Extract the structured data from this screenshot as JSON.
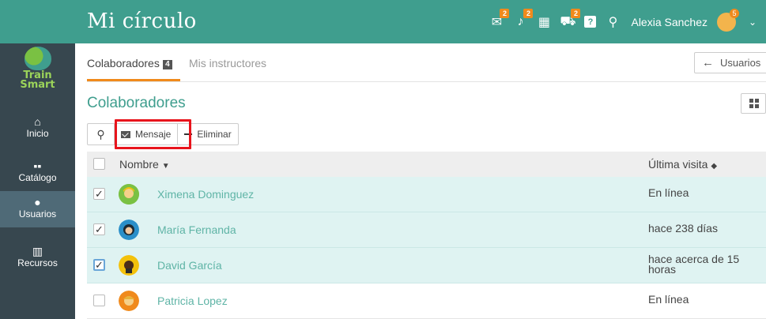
{
  "header": {
    "title": "Mi círculo",
    "user_name": "Alexia Sanchez",
    "icons": [
      {
        "name": "messages-icon",
        "badge": "2"
      },
      {
        "name": "notifications-icon",
        "badge": "2"
      },
      {
        "name": "calendar-icon",
        "badge": ""
      },
      {
        "name": "cart-icon",
        "badge": "2"
      },
      {
        "name": "help-icon",
        "badge": ""
      },
      {
        "name": "search-icon",
        "badge": ""
      }
    ],
    "avatar_badge": "5"
  },
  "sidebar": {
    "logo_line1": "Train",
    "logo_line2": "Smart",
    "items": [
      {
        "label": "Inicio",
        "icon": "home-icon",
        "active": false
      },
      {
        "label": "Catálogo",
        "icon": "grid-icon",
        "active": false
      },
      {
        "label": "Usuarios",
        "icon": "user-icon",
        "active": true
      },
      {
        "label": "Recursos",
        "icon": "library-icon",
        "active": false
      }
    ]
  },
  "tabs": [
    {
      "label": "Colaboradores",
      "count": "4",
      "active": true
    },
    {
      "label": "Mis instructores",
      "active": false
    }
  ],
  "back_button": {
    "label": "Usuarios"
  },
  "section_title": "Colaboradores",
  "toolbar": {
    "message_label": "Mensaje",
    "delete_label": "Eliminar"
  },
  "table": {
    "col_name": "Nombre",
    "col_visit": "Última visita",
    "rows": [
      {
        "name": "Ximena Dominguez",
        "visit": "En línea",
        "checked": true
      },
      {
        "name": "María Fernanda",
        "visit": "hace 238 días",
        "checked": true
      },
      {
        "name": "David García",
        "visit": "hace acerca de 15 horas",
        "checked": true
      },
      {
        "name": "Patricia Lopez",
        "visit": "En línea",
        "checked": false
      }
    ]
  },
  "colors": {
    "brand": "#3f9e8e",
    "sidebar": "#37474f",
    "accent": "#f08a1c",
    "selected_row": "#dff3f2",
    "highlight": "#e8141c"
  }
}
